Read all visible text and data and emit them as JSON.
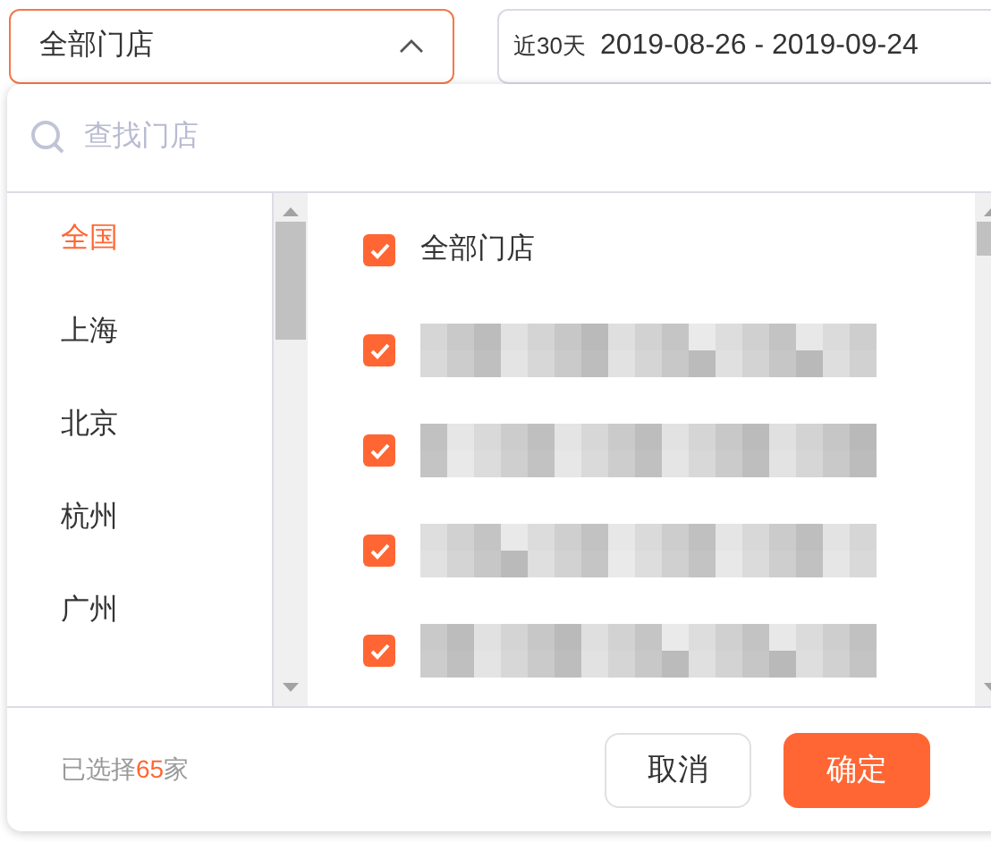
{
  "store_select": {
    "value": "全部门店",
    "expanded": true
  },
  "date_range": {
    "preset": "近30天",
    "range": "2019-08-26 - 2019-09-24"
  },
  "search": {
    "placeholder": "查找门店"
  },
  "cities": [
    {
      "label": "全国",
      "selected": true
    },
    {
      "label": "上海",
      "selected": false
    },
    {
      "label": "北京",
      "selected": false
    },
    {
      "label": "杭州",
      "selected": false
    },
    {
      "label": "广州",
      "selected": false
    }
  ],
  "stores": [
    {
      "kind": "text",
      "label": "全部门店",
      "checked": true
    },
    {
      "kind": "redacted",
      "checked": true
    },
    {
      "kind": "redacted",
      "checked": true
    },
    {
      "kind": "redacted",
      "checked": true
    },
    {
      "kind": "redacted",
      "checked": true
    }
  ],
  "footer": {
    "prefix": "已选择",
    "count": "65",
    "suffix": "家"
  },
  "buttons": [
    {
      "label": "取消",
      "kind": "secondary"
    },
    {
      "label": "确定",
      "kind": "primary"
    }
  ]
}
